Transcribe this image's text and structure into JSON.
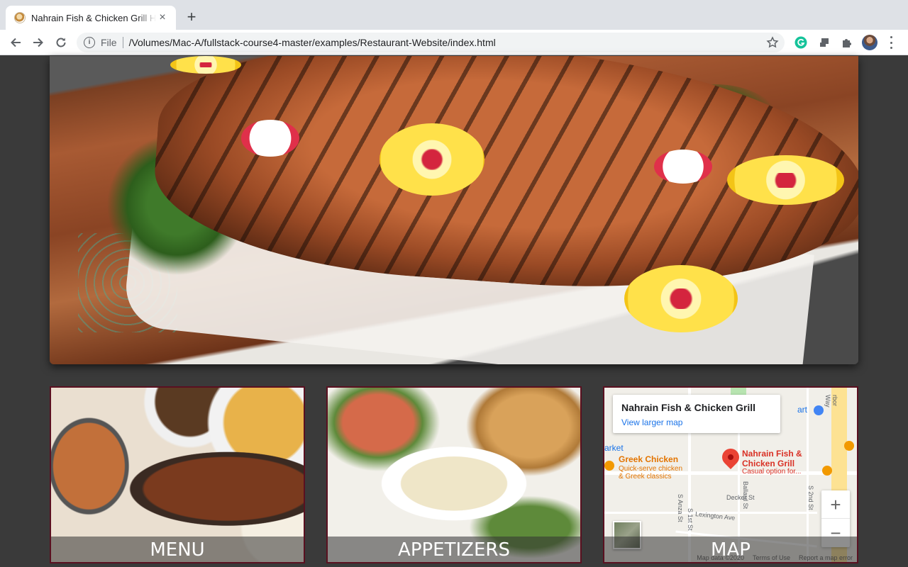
{
  "browser": {
    "tab_title": "Nahrain Fish & Chicken Grill Home",
    "tab_close": "×",
    "new_tab": "+",
    "scheme": "File",
    "url": "/Volumes/Mac-A/fullstack-course4-master/examples/Restaurant-Website/index.html",
    "info_glyph": "i"
  },
  "cards": {
    "menu": "MENU",
    "appetizers": "APPETIZERS",
    "map": "MAP"
  },
  "map": {
    "info_title": "Nahrain Fish & Chicken Grill",
    "info_link": "View larger map",
    "marker_title_1": "Nahrain Fish &",
    "marker_title_2": "Chicken Grill",
    "marker_sub": "Casual option for...",
    "poi_title": "Greek Chicken",
    "poi_sub_1": "Quick-serve chicken",
    "poi_sub_2": "& Greek classics",
    "label_market": "arket",
    "label_mart": "art",
    "street_decker": "Decker St",
    "street_lexington": "Lexington Ave",
    "street_anza": "S Anza St",
    "street_1st": "S 1st St",
    "street_ballard": "Ballard St",
    "street_2nd": "S 2nd St",
    "street_harbor": "rbor Way",
    "footer_data": "Map data ©2020",
    "footer_terms": "Terms of Use",
    "footer_report": "Report a map error",
    "zoom_in": "+",
    "zoom_out": "−"
  },
  "colors": {
    "page_bg": "#3a3a3a",
    "card_border": "#5a1020",
    "marker_red": "#ea4335",
    "poi_orange": "#f29900",
    "link_blue": "#1a73e8"
  }
}
